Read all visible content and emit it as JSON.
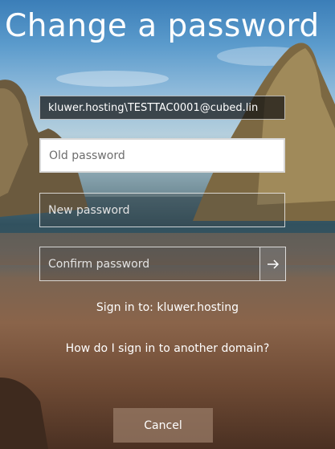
{
  "page": {
    "title": "Change a password"
  },
  "form": {
    "username_value": "kluwer.hosting\\TESTTAC0001@cubed.lin",
    "old_password_placeholder": "Old password",
    "new_password_placeholder": "New password",
    "confirm_password_placeholder": "Confirm password",
    "submit_icon": "arrow-right-icon"
  },
  "footer": {
    "sign_in_to": "Sign in to: kluwer.hosting",
    "other_domain_link": "How do I sign in to another domain?",
    "cancel_label": "Cancel"
  }
}
